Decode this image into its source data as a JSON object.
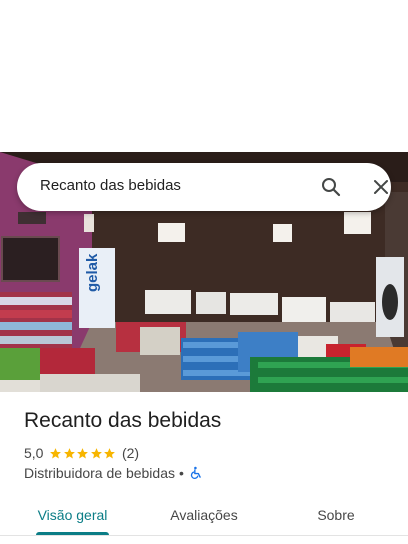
{
  "search": {
    "query": "Recanto das bebidas",
    "search_icon": "search-icon",
    "close_icon": "close-icon"
  },
  "place": {
    "name": "Recanto das bebidas",
    "rating": "5,0",
    "stars_filled": 5,
    "stars_total": 5,
    "review_count": "(2)",
    "category": "Distribuidora de bebidas",
    "separator": "•",
    "accessibility_icon": "wheelchair-icon"
  },
  "photo": {
    "banner_text": "gelak"
  },
  "tabs": [
    {
      "label": "Visão geral",
      "active": true
    },
    {
      "label": "Avaliações",
      "active": false
    },
    {
      "label": "Sobre",
      "active": false
    }
  ],
  "colors": {
    "accent": "#0b7d86",
    "star": "#f7b500",
    "wheelchair": "#1a73e8",
    "text_primary": "#1f1f1f",
    "text_secondary": "#474747"
  }
}
